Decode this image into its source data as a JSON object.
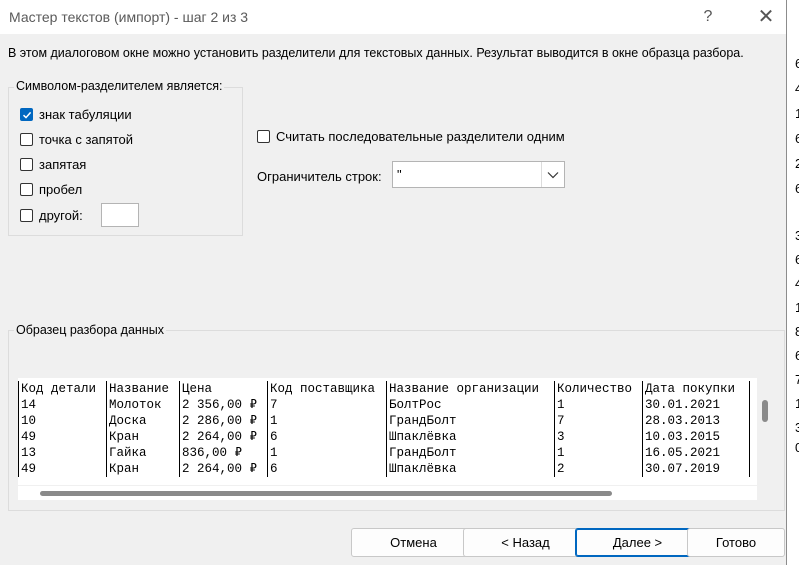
{
  "window": {
    "title": "Мастер текстов (импорт) - шаг 2 из 3",
    "help_symbol": "?",
    "close_symbol": "✕"
  },
  "intro_text": "В этом диалоговом окне можно установить разделители для текстовых данных. Результат выводится в окне образца разбора.",
  "delimiters": {
    "group_label": "Символом-разделителем является:",
    "tab": {
      "label": "знак табуляции",
      "checked": true
    },
    "semicolon": {
      "label": "точка с запятой",
      "checked": false
    },
    "comma": {
      "label": "запятая",
      "checked": false
    },
    "space": {
      "label": "пробел",
      "checked": false
    },
    "other": {
      "label": "другой:",
      "checked": false,
      "value": ""
    }
  },
  "consecutive": {
    "label": "Считать последовательные разделители одним",
    "checked": false
  },
  "qualifier": {
    "label": "Ограничитель строк:",
    "value": "\""
  },
  "preview": {
    "group_label": "Образец разбора данных",
    "headers": [
      "Код детали",
      "Название",
      "Цена",
      "Код поставщика",
      "Название организации",
      "Количество",
      "Дата покупки"
    ],
    "rows": [
      [
        "14",
        "Молоток",
        "2 356,00 ₽",
        "7",
        "БолтРос",
        "1",
        "30.01.2021"
      ],
      [
        "10",
        "Доска",
        "2 286,00 ₽",
        "1",
        "ГрандБолт",
        "7",
        "28.03.2013"
      ],
      [
        "49",
        "Кран",
        "2 264,00 ₽",
        "6",
        "Шпаклёвка",
        "3",
        "10.03.2015"
      ],
      [
        "13",
        "Гайка",
        "836,00 ₽",
        "1",
        "ГрандБолт",
        "1",
        "16.05.2021"
      ],
      [
        "49",
        "Кран",
        "2 264,00 ₽",
        "6",
        "Шпаклёвка",
        "2",
        "30.07.2019"
      ]
    ]
  },
  "buttons": {
    "cancel": "Отмена",
    "back": "< Назад",
    "next": "Далее >",
    "finish": "Готово"
  },
  "background_cells": [
    "6",
    "4",
    "1",
    "6",
    "2",
    "6",
    "3",
    "6",
    "4",
    "1",
    "8",
    "6",
    "7",
    "1",
    "3",
    "0"
  ]
}
